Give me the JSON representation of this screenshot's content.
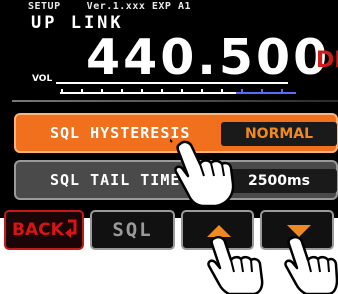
{
  "header": {
    "status_line": "SETUP    Ver.1.xxx EXP A1",
    "mode": "UP LINK",
    "frequency": "440.500",
    "mode_indicator": "DN",
    "vol_label": "VOL"
  },
  "menu": {
    "items": [
      {
        "label": "SQL HYSTERESIS",
        "value": "NORMAL",
        "selected": true
      },
      {
        "label": "SQL TAIL TIME",
        "value": "2500ms",
        "selected": false
      }
    ]
  },
  "softkeys": {
    "back": "BACK",
    "sql": "SQL",
    "up_icon": "arrow-up-icon",
    "down_icon": "arrow-down-icon"
  },
  "colors": {
    "selected_row": "#f0701d",
    "back_key": "#d81414",
    "arrow": "#f08a20",
    "dn": "#d11a1a"
  }
}
